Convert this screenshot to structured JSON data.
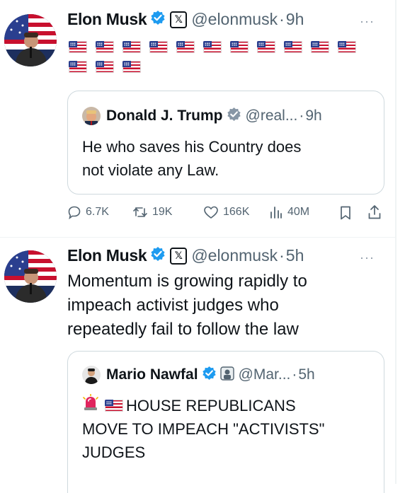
{
  "tweets": [
    {
      "author": {
        "name": "Elon Musk",
        "handle": "@elonmusk",
        "time": "9h"
      },
      "more": "···",
      "flags_count": 14,
      "quote": {
        "author": {
          "name": "Donald J. Trump",
          "handle": "@real...",
          "time": "9h"
        },
        "text_line1": "He who saves his Country does",
        "text_line2": "not violate any Law."
      },
      "actions": {
        "replies": "6.7K",
        "reposts": "19K",
        "likes": "166K",
        "views": "40M"
      }
    },
    {
      "author": {
        "name": "Elon Musk",
        "handle": "@elonmusk",
        "time": "5h"
      },
      "more": "···",
      "text_line1": "Momentum is growing rapidly to",
      "text_line2": "impeach activist judges who",
      "text_line3": "repeatedly fail to follow the law",
      "quote": {
        "author": {
          "name": "Mario Nawfal",
          "handle": "@Mar...",
          "time": "5h"
        },
        "text_line1": "HOUSE REPUBLICANS",
        "text_line2": "MOVE TO IMPEACH \"ACTIVISTS\"",
        "text_line3": "JUDGES"
      }
    }
  ],
  "symbols": {
    "x_logo": "𝕏",
    "dot": "·"
  },
  "colors": {
    "verified": "#1d9bf0",
    "gold": "#e2b719",
    "muted": "#536471",
    "border": "#cfd9de"
  },
  "icons": [
    "verified-badge-icon",
    "gold-badge-icon",
    "x-logo-icon",
    "us-flag-icon",
    "reply-icon",
    "repost-icon",
    "like-icon",
    "views-icon",
    "bookmark-icon",
    "share-icon",
    "siren-icon",
    "more-icon"
  ]
}
